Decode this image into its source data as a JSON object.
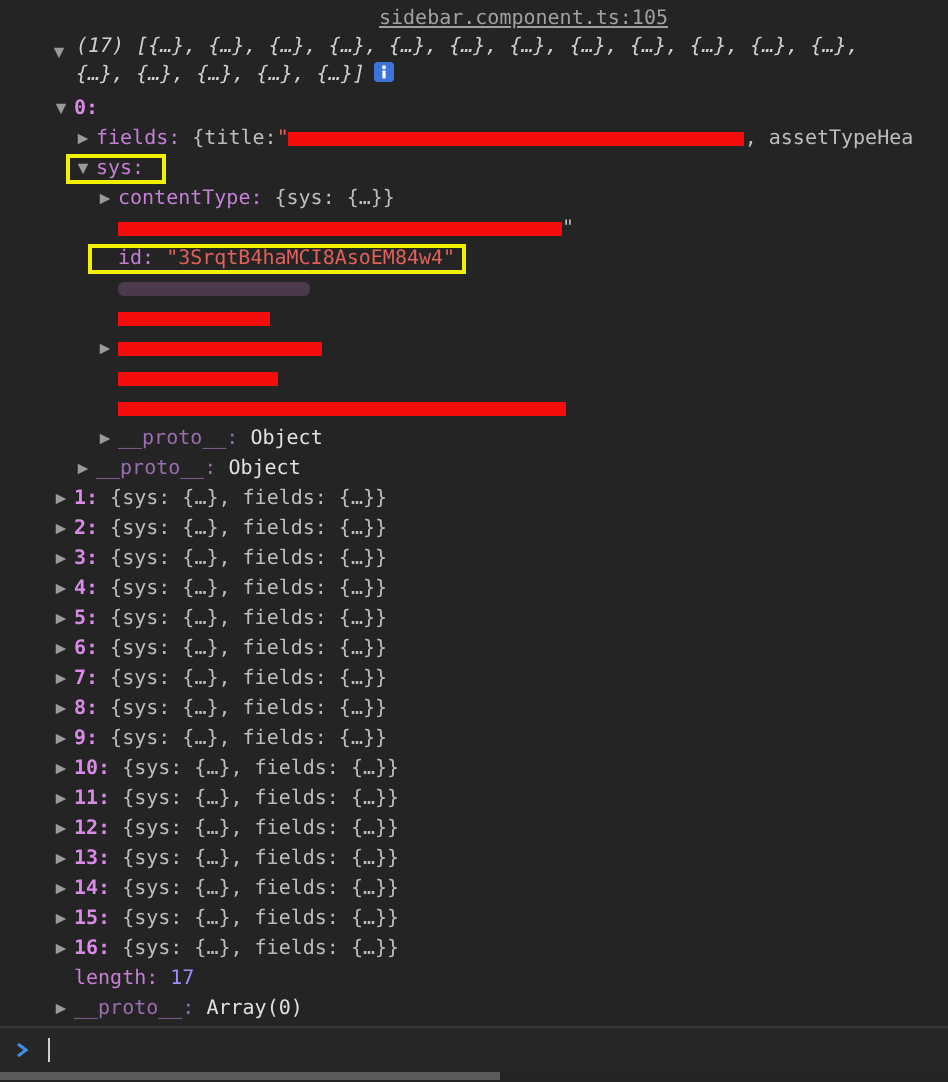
{
  "source_link": "sidebar.component.ts:105",
  "log": {
    "summary": "(17) [{…}, {…}, {…}, {…}, {…}, {…}, {…}, {…}, {…}, {…}, {…}, {…}, {…}, {…}, {…}, {…}, {…}]",
    "expanded": true,
    "children": [
      {
        "kind": "index",
        "key": "0:",
        "expanded": true,
        "children": [
          {
            "kind": "property",
            "key": "fields:",
            "expanded": false,
            "segments": [
              {
                "kind": "text",
                "text": "{title: "
              },
              {
                "kind": "string",
                "text": "\""
              },
              {
                "kind": "redaction"
              },
              {
                "kind": "text",
                "text": ", assetTypeHea"
              }
            ]
          },
          {
            "kind": "property",
            "key": "sys:",
            "expanded": true,
            "highlighted": true,
            "children": [
              {
                "kind": "property",
                "key": "contentType:",
                "expanded": false,
                "segments": [
                  {
                    "kind": "text",
                    "text": "{sys: {…}}"
                  }
                ]
              },
              {
                "kind": "redacted",
                "segments": [
                  {
                    "kind": "redaction"
                  },
                  {
                    "kind": "text",
                    "text": "\""
                  }
                ]
              },
              {
                "kind": "property",
                "key": "id:",
                "highlighted": true,
                "segments": [
                  {
                    "kind": "string",
                    "text": "\"3SrqtB4haMCI8AsoEM84w4\""
                  }
                ]
              },
              {
                "kind": "blurred"
              },
              {
                "kind": "redacted",
                "segments": [
                  {
                    "kind": "redaction"
                  }
                ]
              },
              {
                "kind": "redacted",
                "expanded": false,
                "segments": [
                  {
                    "kind": "redaction"
                  }
                ]
              },
              {
                "kind": "redacted",
                "segments": [
                  {
                    "kind": "redaction"
                  }
                ]
              },
              {
                "kind": "redacted",
                "segments": [
                  {
                    "kind": "redaction"
                  }
                ]
              },
              {
                "kind": "proto",
                "key": "__proto__:",
                "expanded": false,
                "segments": [
                  {
                    "kind": "plain",
                    "text": "Object"
                  }
                ]
              }
            ]
          },
          {
            "kind": "proto",
            "key": "__proto__:",
            "expanded": false,
            "segments": [
              {
                "kind": "plain",
                "text": "Object"
              }
            ]
          }
        ]
      },
      {
        "kind": "index",
        "key": "1:",
        "expanded": false,
        "segments": [
          {
            "kind": "text",
            "text": "{sys: {…}, fields: {…}}"
          }
        ]
      },
      {
        "kind": "index",
        "key": "2:",
        "expanded": false,
        "segments": [
          {
            "kind": "text",
            "text": "{sys: {…}, fields: {…}}"
          }
        ]
      },
      {
        "kind": "index",
        "key": "3:",
        "expanded": false,
        "segments": [
          {
            "kind": "text",
            "text": "{sys: {…}, fields: {…}}"
          }
        ]
      },
      {
        "kind": "index",
        "key": "4:",
        "expanded": false,
        "segments": [
          {
            "kind": "text",
            "text": "{sys: {…}, fields: {…}}"
          }
        ]
      },
      {
        "kind": "index",
        "key": "5:",
        "expanded": false,
        "segments": [
          {
            "kind": "text",
            "text": "{sys: {…}, fields: {…}}"
          }
        ]
      },
      {
        "kind": "index",
        "key": "6:",
        "expanded": false,
        "segments": [
          {
            "kind": "text",
            "text": "{sys: {…}, fields: {…}}"
          }
        ]
      },
      {
        "kind": "index",
        "key": "7:",
        "expanded": false,
        "segments": [
          {
            "kind": "text",
            "text": "{sys: {…}, fields: {…}}"
          }
        ]
      },
      {
        "kind": "index",
        "key": "8:",
        "expanded": false,
        "segments": [
          {
            "kind": "text",
            "text": "{sys: {…}, fields: {…}}"
          }
        ]
      },
      {
        "kind": "index",
        "key": "9:",
        "expanded": false,
        "segments": [
          {
            "kind": "text",
            "text": "{sys: {…}, fields: {…}}"
          }
        ]
      },
      {
        "kind": "index",
        "key": "10:",
        "expanded": false,
        "segments": [
          {
            "kind": "text",
            "text": "{sys: {…}, fields: {…}}"
          }
        ]
      },
      {
        "kind": "index",
        "key": "11:",
        "expanded": false,
        "segments": [
          {
            "kind": "text",
            "text": "{sys: {…}, fields: {…}}"
          }
        ]
      },
      {
        "kind": "index",
        "key": "12:",
        "expanded": false,
        "segments": [
          {
            "kind": "text",
            "text": "{sys: {…}, fields: {…}}"
          }
        ]
      },
      {
        "kind": "index",
        "key": "13:",
        "expanded": false,
        "segments": [
          {
            "kind": "text",
            "text": "{sys: {…}, fields: {…}}"
          }
        ]
      },
      {
        "kind": "index",
        "key": "14:",
        "expanded": false,
        "segments": [
          {
            "kind": "text",
            "text": "{sys: {…}, fields: {…}}"
          }
        ]
      },
      {
        "kind": "index",
        "key": "15:",
        "expanded": false,
        "segments": [
          {
            "kind": "text",
            "text": "{sys: {…}, fields: {…}}"
          }
        ]
      },
      {
        "kind": "index",
        "key": "16:",
        "expanded": false,
        "segments": [
          {
            "kind": "text",
            "text": "{sys: {…}, fields: {…}}"
          }
        ]
      },
      {
        "kind": "property",
        "key": "length:",
        "segments": [
          {
            "kind": "number",
            "text": "17"
          }
        ]
      },
      {
        "kind": "proto",
        "key": "__proto__:",
        "expanded": false,
        "segments": [
          {
            "kind": "plain",
            "text": "Array(0)"
          }
        ]
      }
    ]
  }
}
